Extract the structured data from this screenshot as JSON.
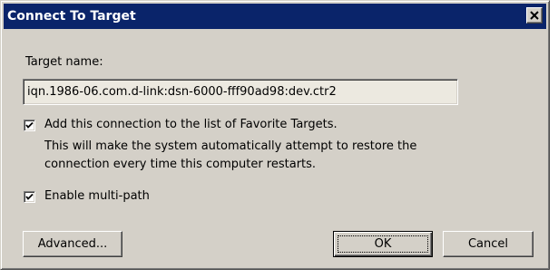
{
  "dialog": {
    "title": "Connect To Target"
  },
  "target": {
    "label": "Target name:",
    "value": "iqn.1986-06.com.d-link:dsn-6000-fff90ad98:dev.ctr2"
  },
  "favorite": {
    "checked": true,
    "label": "Add this connection to the list of Favorite Targets.",
    "description_line1": "This will make the system automatically attempt to restore the",
    "description_line2": "connection every time this computer restarts."
  },
  "multipath": {
    "checked": true,
    "label": "Enable multi-path"
  },
  "buttons": {
    "advanced": "Advanced...",
    "ok": "OK",
    "cancel": "Cancel"
  },
  "icons": {
    "close": "close-icon",
    "check": "checkmark-icon"
  },
  "colors": {
    "titlebar": "#0a246a",
    "window": "#d4d0c8",
    "textfield": "#ece9e0"
  }
}
